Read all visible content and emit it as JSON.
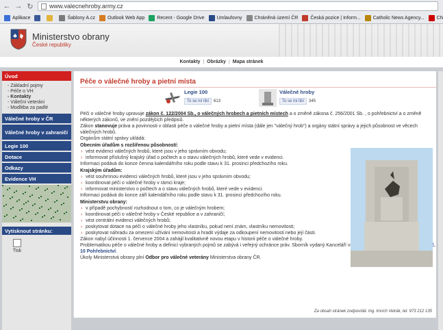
{
  "browser": {
    "url": "www.valecnehroby.army.cz",
    "bookmarks": [
      {
        "label": "Aplikace",
        "color": "#3a6fd8"
      },
      {
        "label": "",
        "color": "#3b5998"
      },
      {
        "label": "",
        "color": "#e2b43b"
      },
      {
        "label": "Šablony A.cz",
        "color": "#7a7a7a"
      },
      {
        "label": "Outlook Web App",
        "color": "#d67c22"
      },
      {
        "label": "Recent - Google Drive",
        "color": "#1aa260"
      },
      {
        "label": "Umlaufovny",
        "color": "#2a4a86"
      },
      {
        "label": "Chráněná území ČR",
        "color": "#888888"
      },
      {
        "label": "Česká pozice | Inform...",
        "color": "#c0392b"
      },
      {
        "label": "Catholic News Agency...",
        "color": "#b8860b"
      },
      {
        "label": "CNN.com International...",
        "color": "#cc0000"
      }
    ]
  },
  "header": {
    "ministry": "Ministerstvo obrany",
    "subtitle": "České republiky"
  },
  "topnav": [
    "Kontakty",
    "Obrázky",
    "Mapa stránek"
  ],
  "sidebar": {
    "uvod": "Úvod",
    "uvod_items": [
      "- Základní pojmy",
      "- Péče o VH",
      "- Kontakty",
      "- Válečni veteráni",
      "- Modlitba za padlé"
    ],
    "sections": [
      "Válečné hroby v ČR",
      "Válečné hroby v zahraničí",
      "Legie 100",
      "Dotace",
      "Odkazy",
      "Evidence VH"
    ],
    "share": "Vytisknout stránku:",
    "print": "Tisk"
  },
  "main": {
    "title": "Péče o válečné hroby a pietní místa",
    "fb": [
      {
        "name": "Legie 100",
        "like": "To se mi líbí",
        "count": "613"
      },
      {
        "name": "Válečné hroby",
        "like": "To se mi líbí",
        "count": "345"
      }
    ],
    "p1_pre": "Péči o válečné hroby upravuje ",
    "p1_link": "zákon č. 122/2004 Sb., o válečných hrobech a pietních místech",
    "p1_post": " a o změně zákona č. 256/2001 Sb. , o pohřebnictví a o změně některých zákonů, ve znění pozdějších předpisů.",
    "p2_pre": "Zákon ",
    "p2_bold": "stanovuje",
    "p2_post": " práva a povinnosti v oblasti péče o válečné hroby a pietní místa (dále jen \"válečný hrob\") a orgány státní správy a jejich působnost ve věcech válečných hrobů.",
    "p3": "Orgánům státní správy ukládá:",
    "sec1": "Obecním úřadům s rozšířenou působností:",
    "sec1_items": [
      "vést evidenci válečných hrobů, které jsou v jeho správním obvodu;",
      "informovat příslušný krajský úřad o počtech a o stavu válečných hrobů, které vede v evidenci."
    ],
    "sec1_note": "Informaci podává do konce června kalendářního roku podle stavu k 31. prosinci předchozího roku.",
    "sec2": "Krajským úřadům:",
    "sec2_items": [
      "vést souhrnnou evidenci válečných hrobů, které jsou v jeho správním obvodu;",
      "koordinovat péči o válečné hroby v rámci kraje;",
      "informovat ministerstvo o počtech a o stavu válečných hrobů, které vede v evidenci."
    ],
    "sec2_note": "Informaci podává do konce září kalendářního roku podle stavu k 31. prosinci předchozího roku.",
    "sec3": "Ministerstvu obrany:",
    "sec3_items": [
      "v případě pochybností rozhodnout o tom, co je válečným hrobem;",
      "koordinovat péči o válečné hroby v České republice a v zahraničí;",
      "vést centrální evidenci válečných hrobů;",
      "poskytovat dotace na péči o válečné hroby jeho vlastníku, pokud není znám, vlastníku nemovitosti;",
      "poskytovat náhradu za omezení užívání nemovitosti a hradit výdaje za odkoupení nemovitosti nebo její části."
    ],
    "p4": "Zákon nabyl účinnosti 1. července 2004 a zahájil kvalitativně novou etapu v historii péče o válečné hroby.",
    "p5_pre": "Problematikou péče o válečné hroby a definicí vybraných pojmů se zabývá i veřejný ochránce práv. Sborník vydaný Kanceláří veřejného ochránce práv - ",
    "p5_link": "Stanoviska č. 10 Pohřebnictví",
    "p5_post": ".",
    "p6_pre": "Úkoly Ministerstvá obrany plní ",
    "p6_bold": "Odbor pro válečné veterány",
    "p6_post": " Ministerstva obrany ČR.",
    "footer": "Za obsah stránek zodpovídá: Ing. Imrich Vetrák, tel. 973 212 135"
  }
}
